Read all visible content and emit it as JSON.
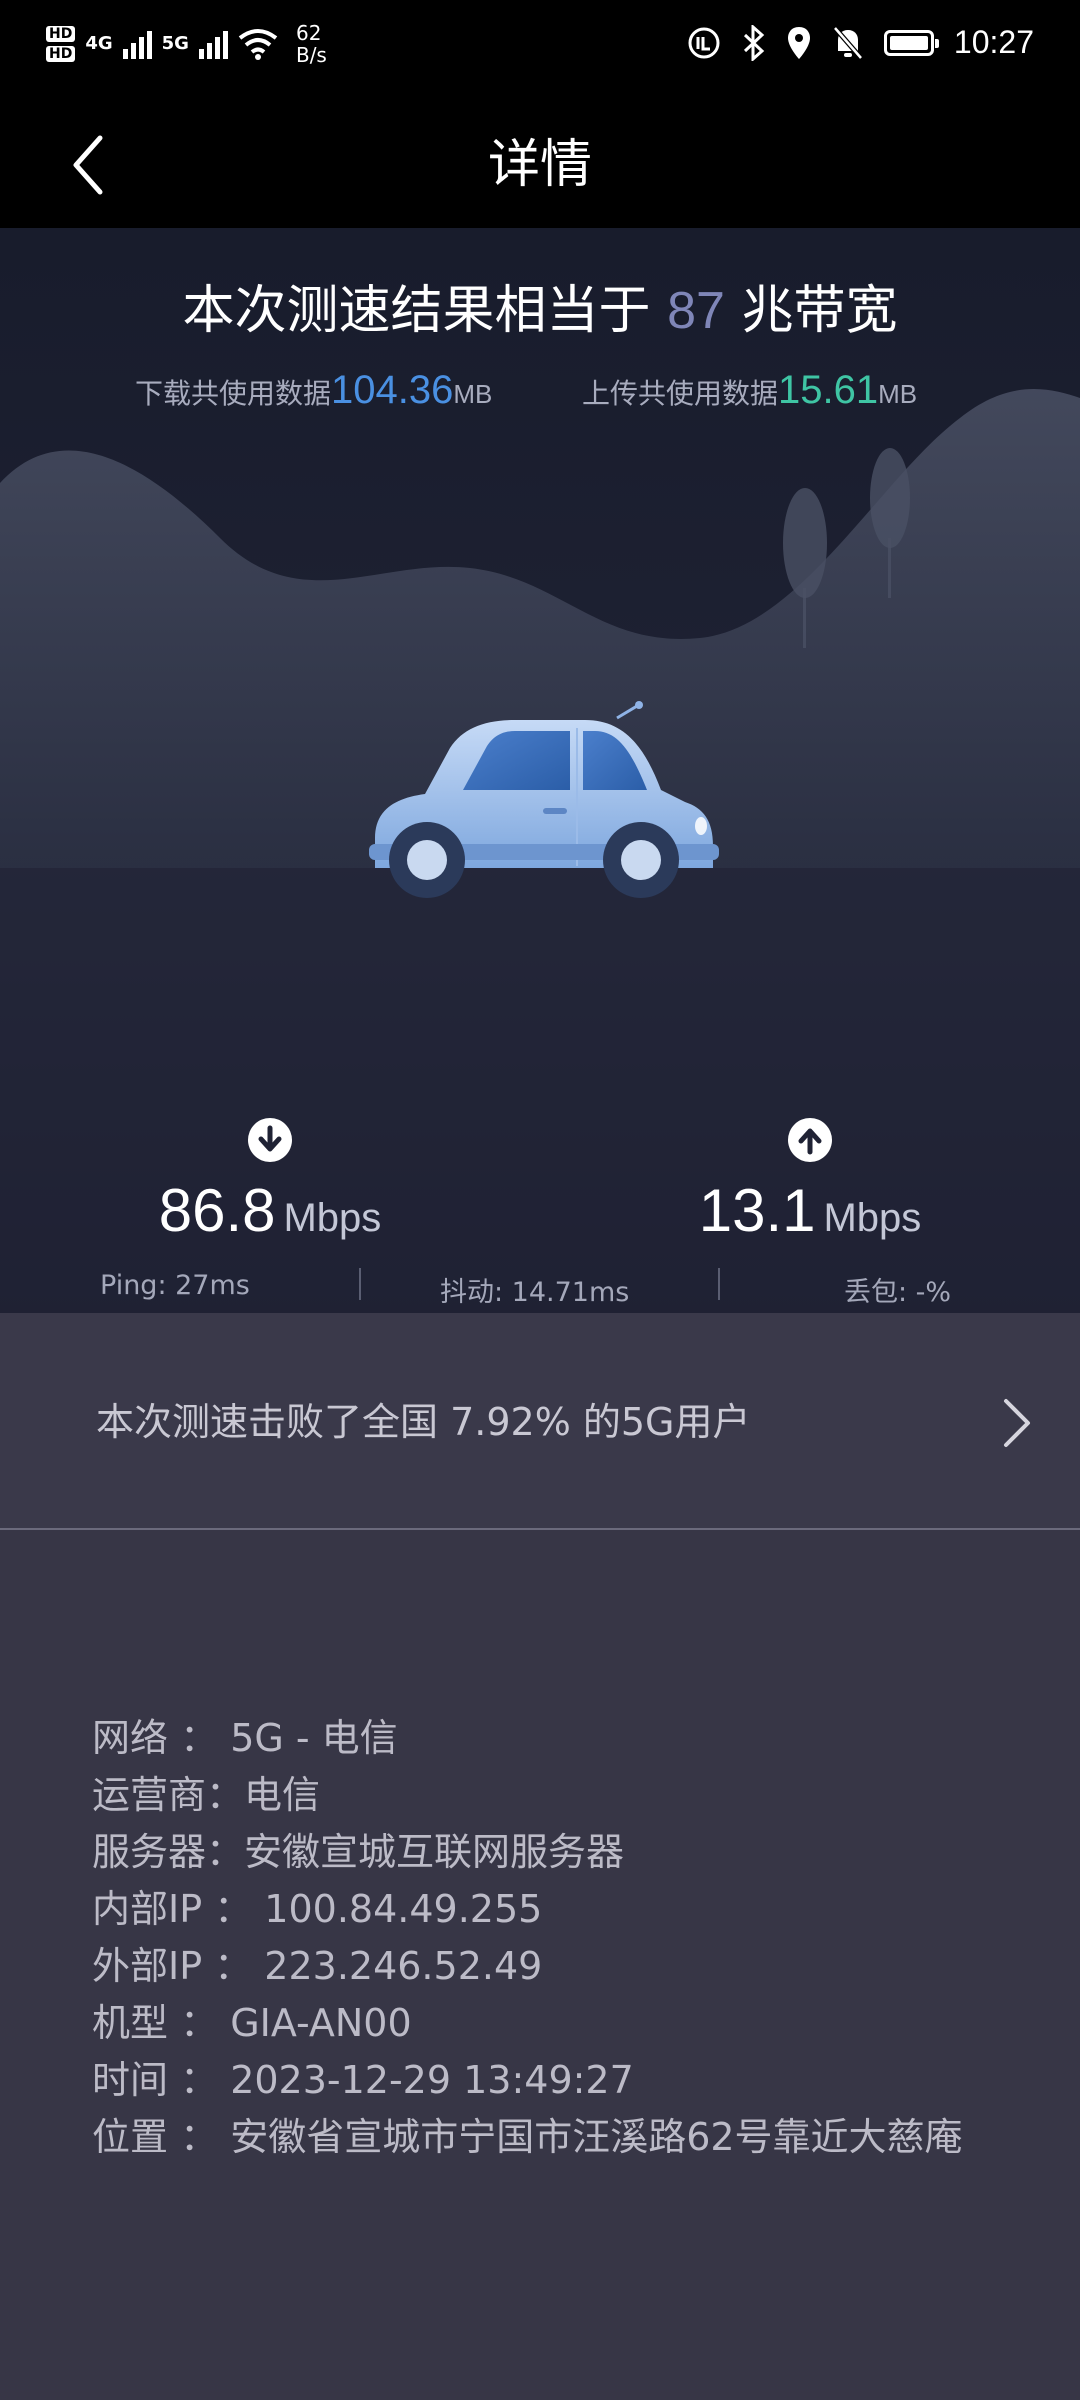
{
  "status_bar": {
    "network_1": "4G",
    "network_2": "5G",
    "net_speed_value": "62",
    "net_speed_unit": "B/s",
    "time": "10:27",
    "icons": [
      "hd-icon",
      "signal-icon",
      "wifi-icon",
      "data-saver-icon",
      "bluetooth-icon",
      "location-icon",
      "mute-icon",
      "battery-icon"
    ]
  },
  "header": {
    "title": "详情",
    "back_icon": "chevron-left-icon"
  },
  "result": {
    "prefix": "本次测速结果相当于",
    "bandwidth": "87",
    "suffix": "兆带宽",
    "download_usage_label": "下载共使用数据",
    "download_usage_value": "104.36",
    "download_usage_unit": "MB",
    "upload_usage_label": "上传共使用数据",
    "upload_usage_value": "15.61",
    "upload_usage_unit": "MB"
  },
  "speeds": {
    "download_value": "86.8",
    "download_unit": "Mbps",
    "upload_value": "13.1",
    "upload_unit": "Mbps"
  },
  "stats": {
    "ping": "Ping:  27ms",
    "jitter": "抖动:  14.71ms",
    "loss": "丢包:  -%"
  },
  "rank": {
    "text": "本次测速击败了全国 7.92% 的5G用户"
  },
  "info": [
    {
      "label": "网络",
      "colon": " ： ",
      "value": "5G - 电信"
    },
    {
      "label": "运营商",
      "colon": "：",
      "value": "电信"
    },
    {
      "label": "服务器",
      "colon": "：",
      "value": "安徽宣城互联网服务器"
    },
    {
      "label": "内部IP",
      "colon": " ： ",
      "value": "100.84.49.255"
    },
    {
      "label": "外部IP",
      "colon": " ： ",
      "value": "223.246.52.49"
    },
    {
      "label": "机型",
      "colon": " ： ",
      "value": "GIA-AN00"
    },
    {
      "label": "时间",
      "colon": " ： ",
      "value": "2023-12-29 13:49:27"
    },
    {
      "label": "位置",
      "colon": " ： ",
      "value": "安徽省宣城市宁国市汪溪路62号靠近大慈庵"
    }
  ],
  "colors": {
    "download_accent": "#4a90e2",
    "upload_accent": "#3fc5a4",
    "bandwidth_accent": "#7f86b8"
  }
}
